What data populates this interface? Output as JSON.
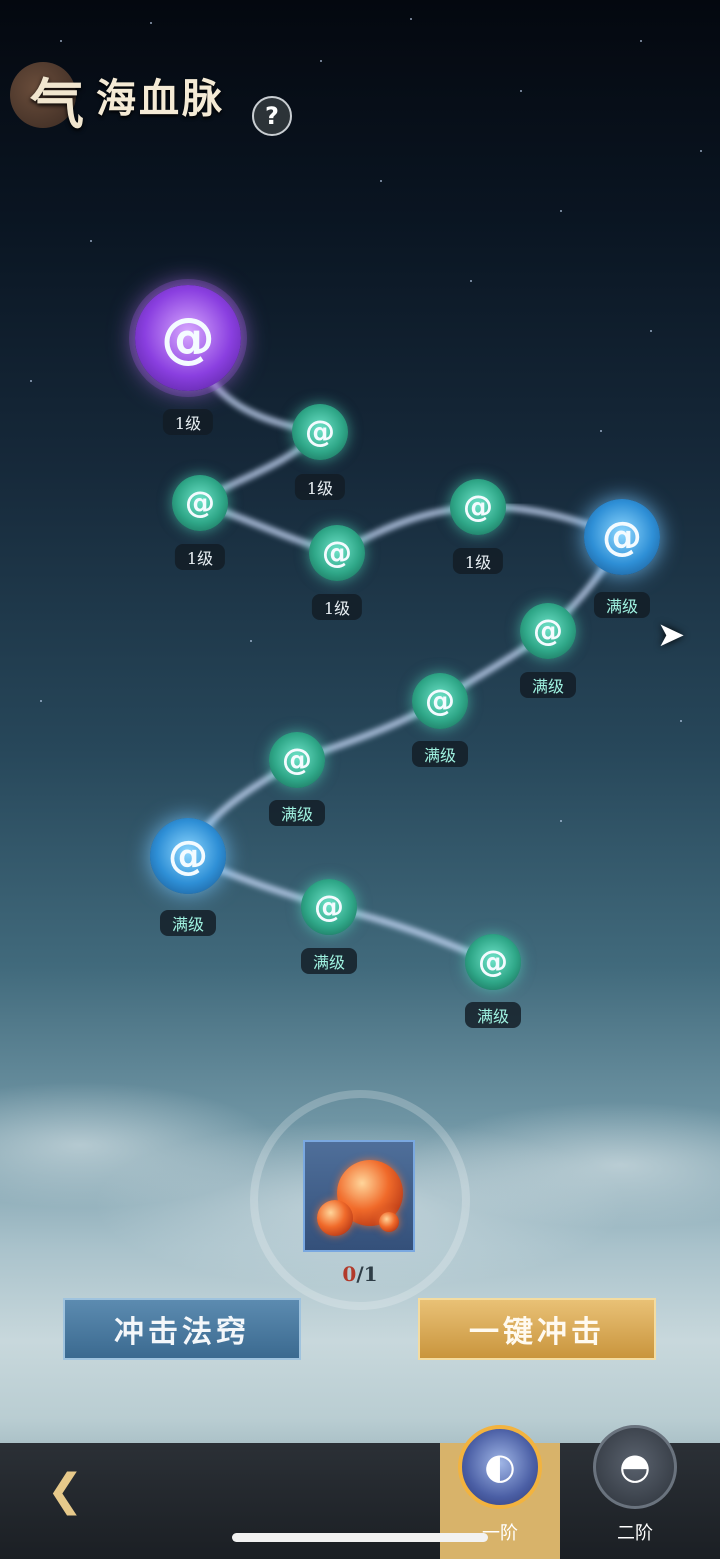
{
  "header": {
    "title_first_char": "气",
    "title_rest": "海血脉",
    "help_label": "?"
  },
  "meridian": {
    "nodes": [
      {
        "label": "1级"
      },
      {
        "label": "1级"
      },
      {
        "label": "1级"
      },
      {
        "label": "1级"
      },
      {
        "label": "1级"
      },
      {
        "label": "满级"
      },
      {
        "label": "满级"
      },
      {
        "label": "满级"
      },
      {
        "label": "满级"
      },
      {
        "label": "满级"
      },
      {
        "label": "满级"
      },
      {
        "label": "满级"
      }
    ],
    "next_icon": "arrow-right-icon"
  },
  "cost": {
    "item_icon": "fire-orb-icon",
    "have": "0",
    "separator_need": "/1"
  },
  "actions": {
    "impact_label": "冲击法窍",
    "one_key_label": "一键冲击"
  },
  "footer": {
    "back_icon": "back-arrow-icon",
    "tabs": [
      {
        "label": "一阶",
        "active": true
      },
      {
        "label": "二阶",
        "active": false
      }
    ]
  }
}
